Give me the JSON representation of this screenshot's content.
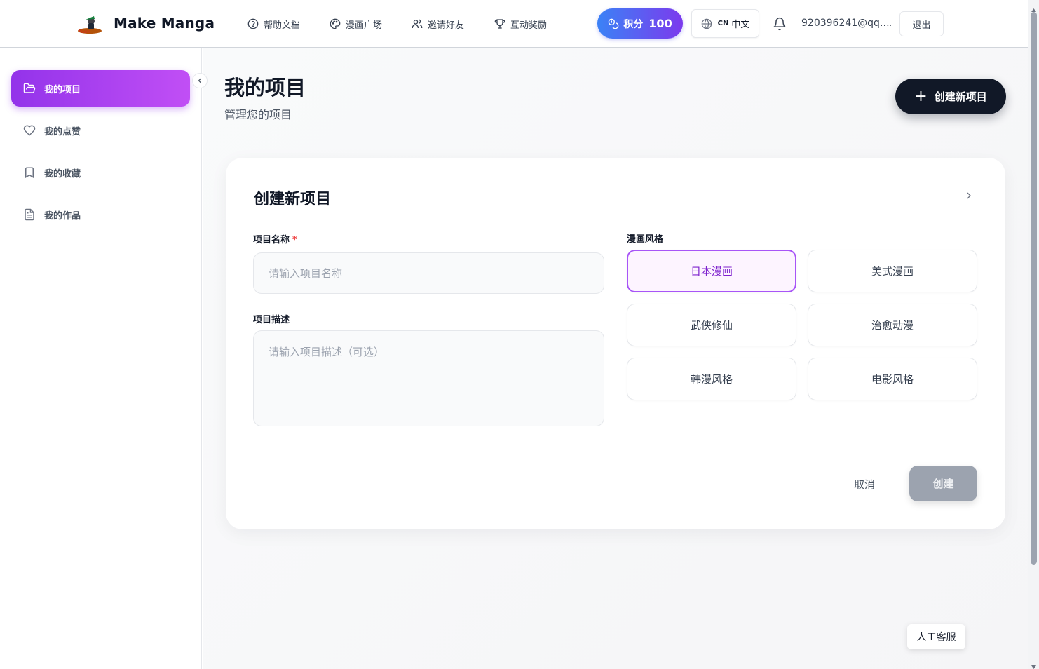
{
  "header": {
    "logo_name": "Make Manga",
    "nav": [
      {
        "label": "帮助文档",
        "icon": "help-circle-icon"
      },
      {
        "label": "漫画广场",
        "icon": "palette-icon"
      },
      {
        "label": "邀请好友",
        "icon": "users-icon"
      },
      {
        "label": "互动奖励",
        "icon": "trophy-icon"
      }
    ],
    "points_label": "积分",
    "points_value": "100",
    "lang_code": "CN",
    "lang_label": "中文",
    "email": "920396241@qq.…",
    "logout": "退出"
  },
  "sidebar": {
    "items": [
      {
        "label": "我的项目",
        "icon": "folder-open-icon",
        "active": true
      },
      {
        "label": "我的点赞",
        "icon": "heart-icon",
        "active": false
      },
      {
        "label": "我的收藏",
        "icon": "bookmark-icon",
        "active": false
      },
      {
        "label": "我的作品",
        "icon": "file-text-icon",
        "active": false
      }
    ]
  },
  "page": {
    "title": "我的项目",
    "subtitle": "管理您的项目",
    "create_button": "创建新项目"
  },
  "form": {
    "title": "创建新项目",
    "name_label": "项目名称",
    "required_mark": "*",
    "name_placeholder": "请输入项目名称",
    "desc_label": "项目描述",
    "desc_placeholder": "请输入项目描述（可选）",
    "style_label": "漫画风格",
    "styles": [
      "日本漫画",
      "美式漫画",
      "武侠修仙",
      "治愈动漫",
      "韩漫风格",
      "电影风格"
    ],
    "selected_style": "日本漫画",
    "cancel": "取消",
    "submit": "创建"
  },
  "support": "人工客服",
  "colors": {
    "accent_purple": "#9333ea",
    "points_gradient_start": "#3b82f6",
    "points_gradient_end": "#7c3aed",
    "dark_button": "#111827",
    "disabled_button": "#9ca3af"
  }
}
